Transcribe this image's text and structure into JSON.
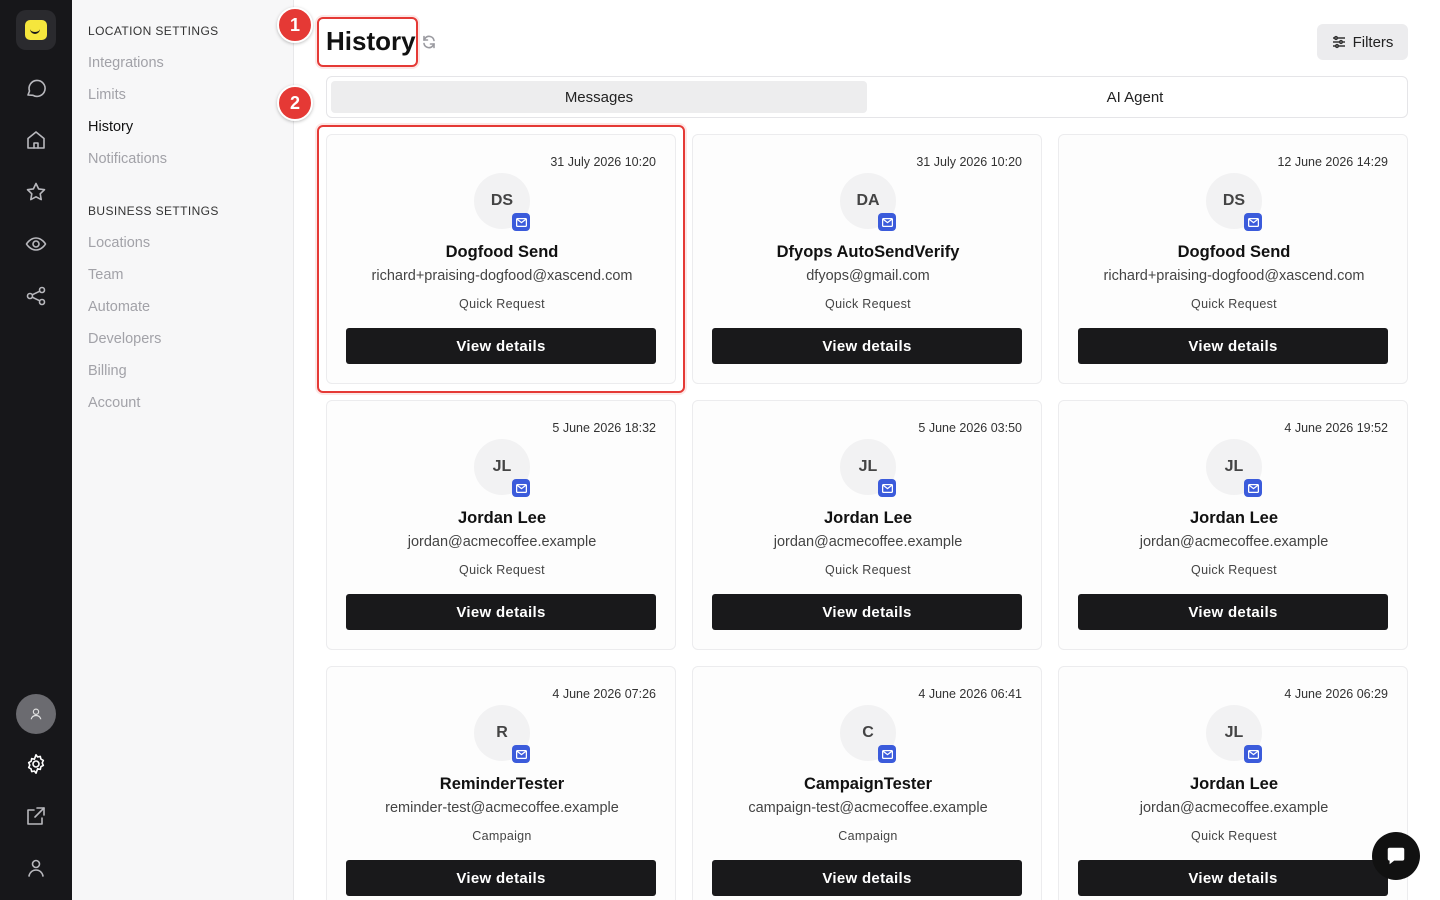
{
  "sidebar": {
    "location_title": "LOCATION SETTINGS",
    "location_items": [
      {
        "label": "Integrations",
        "active": false
      },
      {
        "label": "Limits",
        "active": false
      },
      {
        "label": "History",
        "active": true
      },
      {
        "label": "Notifications",
        "active": false
      }
    ],
    "business_title": "BUSINESS SETTINGS",
    "business_items": [
      {
        "label": "Locations"
      },
      {
        "label": "Team"
      },
      {
        "label": "Automate"
      },
      {
        "label": "Developers"
      },
      {
        "label": "Billing"
      },
      {
        "label": "Account"
      }
    ]
  },
  "header": {
    "title": "History",
    "filters_label": "Filters"
  },
  "tabs": [
    {
      "label": "Messages",
      "active": true
    },
    {
      "label": "AI Agent",
      "active": false
    }
  ],
  "annotations": [
    "1",
    "2"
  ],
  "cards": [
    {
      "date": "31 July 2026 10:20",
      "initials": "DS",
      "name": "Dogfood Send",
      "email": "richard+praising-dogfood@xascend.com",
      "tag": "Quick Request",
      "button": "View details"
    },
    {
      "date": "31 July 2026 10:20",
      "initials": "DA",
      "name": "Dfyops AutoSendVerify",
      "email": "dfyops@gmail.com",
      "tag": "Quick Request",
      "button": "View details"
    },
    {
      "date": "12 June 2026 14:29",
      "initials": "DS",
      "name": "Dogfood Send",
      "email": "richard+praising-dogfood@xascend.com",
      "tag": "Quick Request",
      "button": "View details"
    },
    {
      "date": "5 June 2026 18:32",
      "initials": "JL",
      "name": "Jordan Lee",
      "email": "jordan@acmecoffee.example",
      "tag": "Quick Request",
      "button": "View details"
    },
    {
      "date": "5 June 2026 03:50",
      "initials": "JL",
      "name": "Jordan Lee",
      "email": "jordan@acmecoffee.example",
      "tag": "Quick Request",
      "button": "View details"
    },
    {
      "date": "4 June 2026 19:52",
      "initials": "JL",
      "name": "Jordan Lee",
      "email": "jordan@acmecoffee.example",
      "tag": "Quick Request",
      "button": "View details"
    },
    {
      "date": "4 June 2026 07:26",
      "initials": "R",
      "name": "ReminderTester",
      "email": "reminder-test@acmecoffee.example",
      "tag": "Campaign",
      "button": "View details"
    },
    {
      "date": "4 June 2026 06:41",
      "initials": "C",
      "name": "CampaignTester",
      "email": "campaign-test@acmecoffee.example",
      "tag": "Campaign",
      "button": "View details"
    },
    {
      "date": "4 June 2026 06:29",
      "initials": "JL",
      "name": "Jordan Lee",
      "email": "jordan@acmecoffee.example",
      "tag": "Quick Request",
      "button": "View details"
    }
  ],
  "colors": {
    "rail_bg": "#17171a",
    "brand_yellow": "#f5e63d",
    "annotation_red": "#e53935",
    "mail_badge_blue": "#3b5bdb",
    "button_dark": "#19191b"
  },
  "icons": {
    "rail": [
      "logo-icon",
      "chat-bubble-icon",
      "home-icon",
      "star-icon",
      "eye-icon",
      "share-icon",
      "user-avatar-icon",
      "gear-icon",
      "external-link-icon",
      "person-icon"
    ],
    "refresh": "refresh-icon",
    "filters": "sliders-icon",
    "mail": "mail-icon",
    "chat_fab": "chat-icon"
  }
}
